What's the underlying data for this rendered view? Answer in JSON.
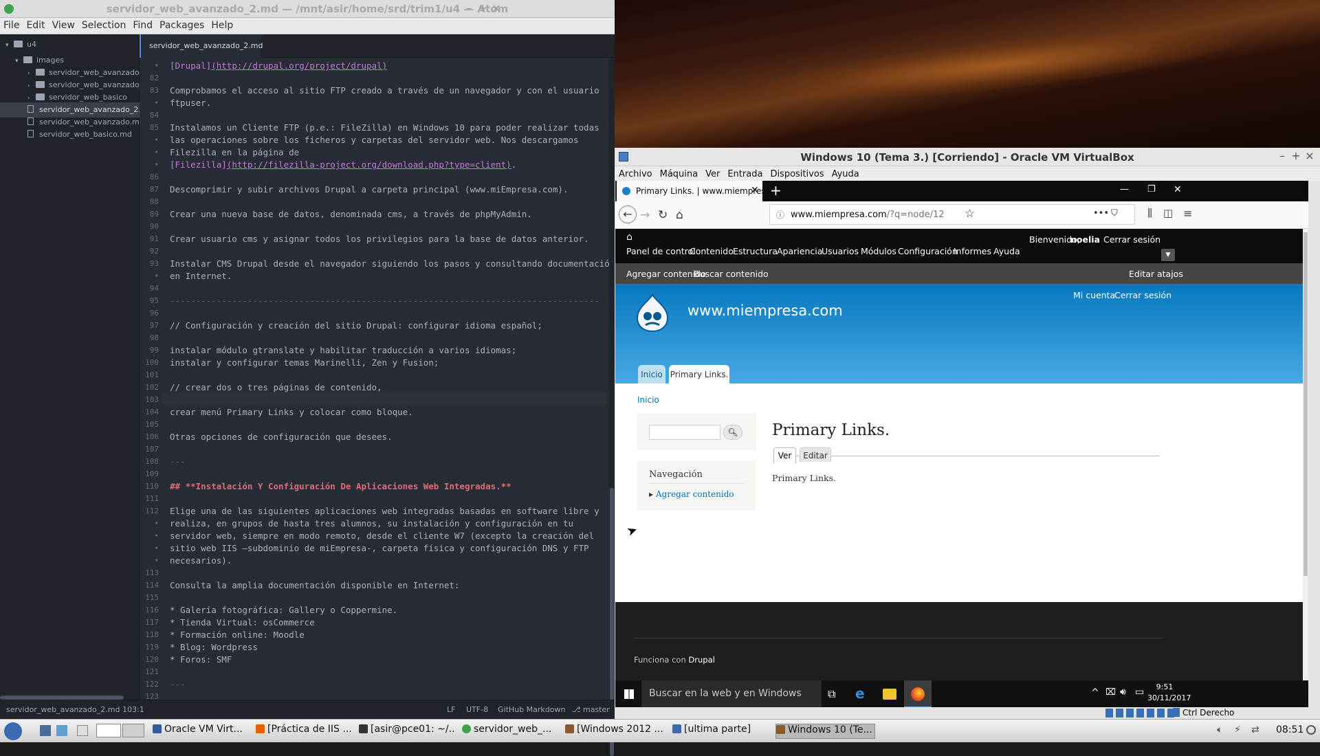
{
  "atom": {
    "title": "servidor_web_avanzado_2.md — /mnt/asir/home/srd/trim1/u4 — Atom",
    "menu": [
      "File",
      "Edit",
      "View",
      "Selection",
      "Find",
      "Packages",
      "Help"
    ],
    "tree": {
      "root": "u4",
      "items": [
        {
          "label": "images",
          "type": "folder"
        },
        {
          "label": "servidor_web_avanzado",
          "type": "folder"
        },
        {
          "label": "servidor_web_avanzado_",
          "type": "folder"
        },
        {
          "label": "servidor_web_basico",
          "type": "folder"
        },
        {
          "label": "servidor_web_avanzado_2.m",
          "type": "file"
        },
        {
          "label": "servidor_web_avanzado.md",
          "type": "file"
        },
        {
          "label": "servidor_web_basico.md",
          "type": "file"
        }
      ]
    },
    "tab": "servidor_web_avanzado_2.md",
    "lines": [
      {
        "n": "•",
        "t": "[Drupal]",
        "link": "(http://drupal.org/project/drupal)"
      },
      {
        "n": "82",
        "t": ""
      },
      {
        "n": "83",
        "t": "Comprobamos el acceso al sitio FTP creado a través de un navegador y con el usuario"
      },
      {
        "n": "•",
        "t": "ftpuser."
      },
      {
        "n": "84",
        "t": ""
      },
      {
        "n": "85",
        "t": "Instalamos un Cliente FTP (p.e.: FileZilla) en Windows 10 para poder realizar todas"
      },
      {
        "n": "•",
        "t": "las operaciones sobre los ficheros y carpetas del servidor web. Nos descargamos"
      },
      {
        "n": "•",
        "t": "Filezilla en la página de"
      },
      {
        "n": "•",
        "t": "[Filezilla]",
        "link": "(http://filezilla-project.org/download.php?type=client)",
        "after": "."
      },
      {
        "n": "86",
        "t": ""
      },
      {
        "n": "87",
        "t": "Descomprimir y subir archivos Drupal a carpeta principal (www.miEmpresa.com)."
      },
      {
        "n": "88",
        "t": ""
      },
      {
        "n": "89",
        "t": "Crear una nueva base de datos, denominada cms, a través de phpMyAdmin."
      },
      {
        "n": "90",
        "t": ""
      },
      {
        "n": "91",
        "t": "Crear usuario cms y asignar todos los privilegios para la base de datos anterior."
      },
      {
        "n": "92",
        "t": ""
      },
      {
        "n": "93",
        "t": "Instalar CMS Drupal desde el navegador siguiendo los pasos y consultando documentación"
      },
      {
        "n": "•",
        "t": "en Internet."
      },
      {
        "n": "94",
        "t": ""
      },
      {
        "n": "95",
        "t": "-----------------------------------------------------------------------------------",
        "rule": true
      },
      {
        "n": "96",
        "t": ""
      },
      {
        "n": "97",
        "t": "// Configuración y creación del sitio Drupal: configurar idioma español;"
      },
      {
        "n": "98",
        "t": ""
      },
      {
        "n": "99",
        "t": "instalar módulo gtranslate y habilitar traducción a varios idiomas;"
      },
      {
        "n": "100",
        "t": "instalar y configurar temas Marinelli, Zen y Fusion;"
      },
      {
        "n": "101",
        "t": ""
      },
      {
        "n": "102",
        "t": "// crear dos o tres páginas de contenido,"
      },
      {
        "n": "103",
        "t": ""
      },
      {
        "n": "104",
        "t": "crear menú Primary Links y colocar como bloque."
      },
      {
        "n": "105",
        "t": ""
      },
      {
        "n": "106",
        "t": "Otras opciones de configuración que desees."
      },
      {
        "n": "107",
        "t": ""
      },
      {
        "n": "108",
        "t": "---",
        "rule": true
      },
      {
        "n": "109",
        "t": ""
      },
      {
        "n": "110",
        "t": "## **Instalación Y Configuración De Aplicaciones Web Integradas.**",
        "head": true
      },
      {
        "n": "111",
        "t": ""
      },
      {
        "n": "112",
        "t": "Elige una de las siguientes aplicaciones web integradas basadas en software libre y"
      },
      {
        "n": "•",
        "t": "realiza, en grupos de hasta tres alumnos, su instalación y configuración en tu"
      },
      {
        "n": "•",
        "t": "servidor web, siempre en modo remoto, desde el cliente W7 (excepto la creación del"
      },
      {
        "n": "•",
        "t": "sitio web IIS –subdominio de miEmpresa-, carpeta física y configuración DNS y FTP"
      },
      {
        "n": "•",
        "t": "necesarios)."
      },
      {
        "n": "113",
        "t": ""
      },
      {
        "n": "114",
        "t": "Consulta la amplia documentación disponible en Internet:"
      },
      {
        "n": "115",
        "t": ""
      },
      {
        "n": "116",
        "t": "* Galería fotográfica: Gallery o Coppermine."
      },
      {
        "n": "117",
        "t": "* Tienda Virtual: osCommerce"
      },
      {
        "n": "118",
        "t": "* Formación online: Moodle"
      },
      {
        "n": "119",
        "t": "* Blog: Wordpress"
      },
      {
        "n": "120",
        "t": "* Foros: SMF"
      },
      {
        "n": "121",
        "t": ""
      },
      {
        "n": "122",
        "t": "---",
        "rule": true
      },
      {
        "n": "123",
        "t": ""
      }
    ],
    "status": {
      "file": "servidor_web_avanzado_2.md",
      "pos": "103:1",
      "eol": "LF",
      "enc": "UTF-8",
      "grammar": "GitHub Markdown",
      "branch": "master"
    }
  },
  "vbox": {
    "title": "Windows 10 (Tema 3.) [Corriendo] - Oracle VM VirtualBox",
    "menu": [
      "Archivo",
      "Máquina",
      "Ver",
      "Entrada",
      "Dispositivos",
      "Ayuda"
    ],
    "host_key": "Ctrl Derecho"
  },
  "firefox": {
    "tab_title": "Primary Links. | www.miempresa",
    "url_host": "www.miempresa.com",
    "url_path": "/?q=node/12"
  },
  "drupal": {
    "toolbar": [
      "Panel de control",
      "Contenido",
      "Estructura",
      "Apariencia",
      "Usuarios",
      "Módulos",
      "Configuración",
      "Informes",
      "Ayuda"
    ],
    "welcome": "Bienvenido,",
    "user": "noelia",
    "logout": "Cerrar sesión",
    "shortcuts": [
      "Agregar contenido",
      "Buscar contenido"
    ],
    "edit_shortcuts": "Editar atajos",
    "header_links": [
      "Mi cuenta",
      "Cerrar sesión"
    ],
    "site_name": "www.miempresa.com",
    "tabs": [
      "Inicio",
      "Primary Links."
    ],
    "breadcrumb": "Inicio",
    "nav_title": "Navegación",
    "nav_item": "Agregar contenido",
    "page_title": "Primary Links.",
    "page_tabs": [
      "Ver",
      "Editar"
    ],
    "body": "Primary Links.",
    "footer_prefix": "Funciona con",
    "footer_link": "Drupal"
  },
  "win10": {
    "search": "Buscar en la web y en Windows",
    "time": "9:51",
    "date": "30/11/2017"
  },
  "host_taskbar": {
    "items": [
      "Oracle VM Virt...",
      "[Práctica de IIS ...",
      "[asir@pce01: ~/...",
      "servidor_web_...",
      "[Windows 2012 ...",
      "[ultima parte]",
      "Windows 10 (Te..."
    ],
    "clock": "08:51"
  },
  "colors": {
    "atom_bg": "#282c34",
    "drupal_blue": "#0779bf",
    "link": "#c678dd"
  }
}
